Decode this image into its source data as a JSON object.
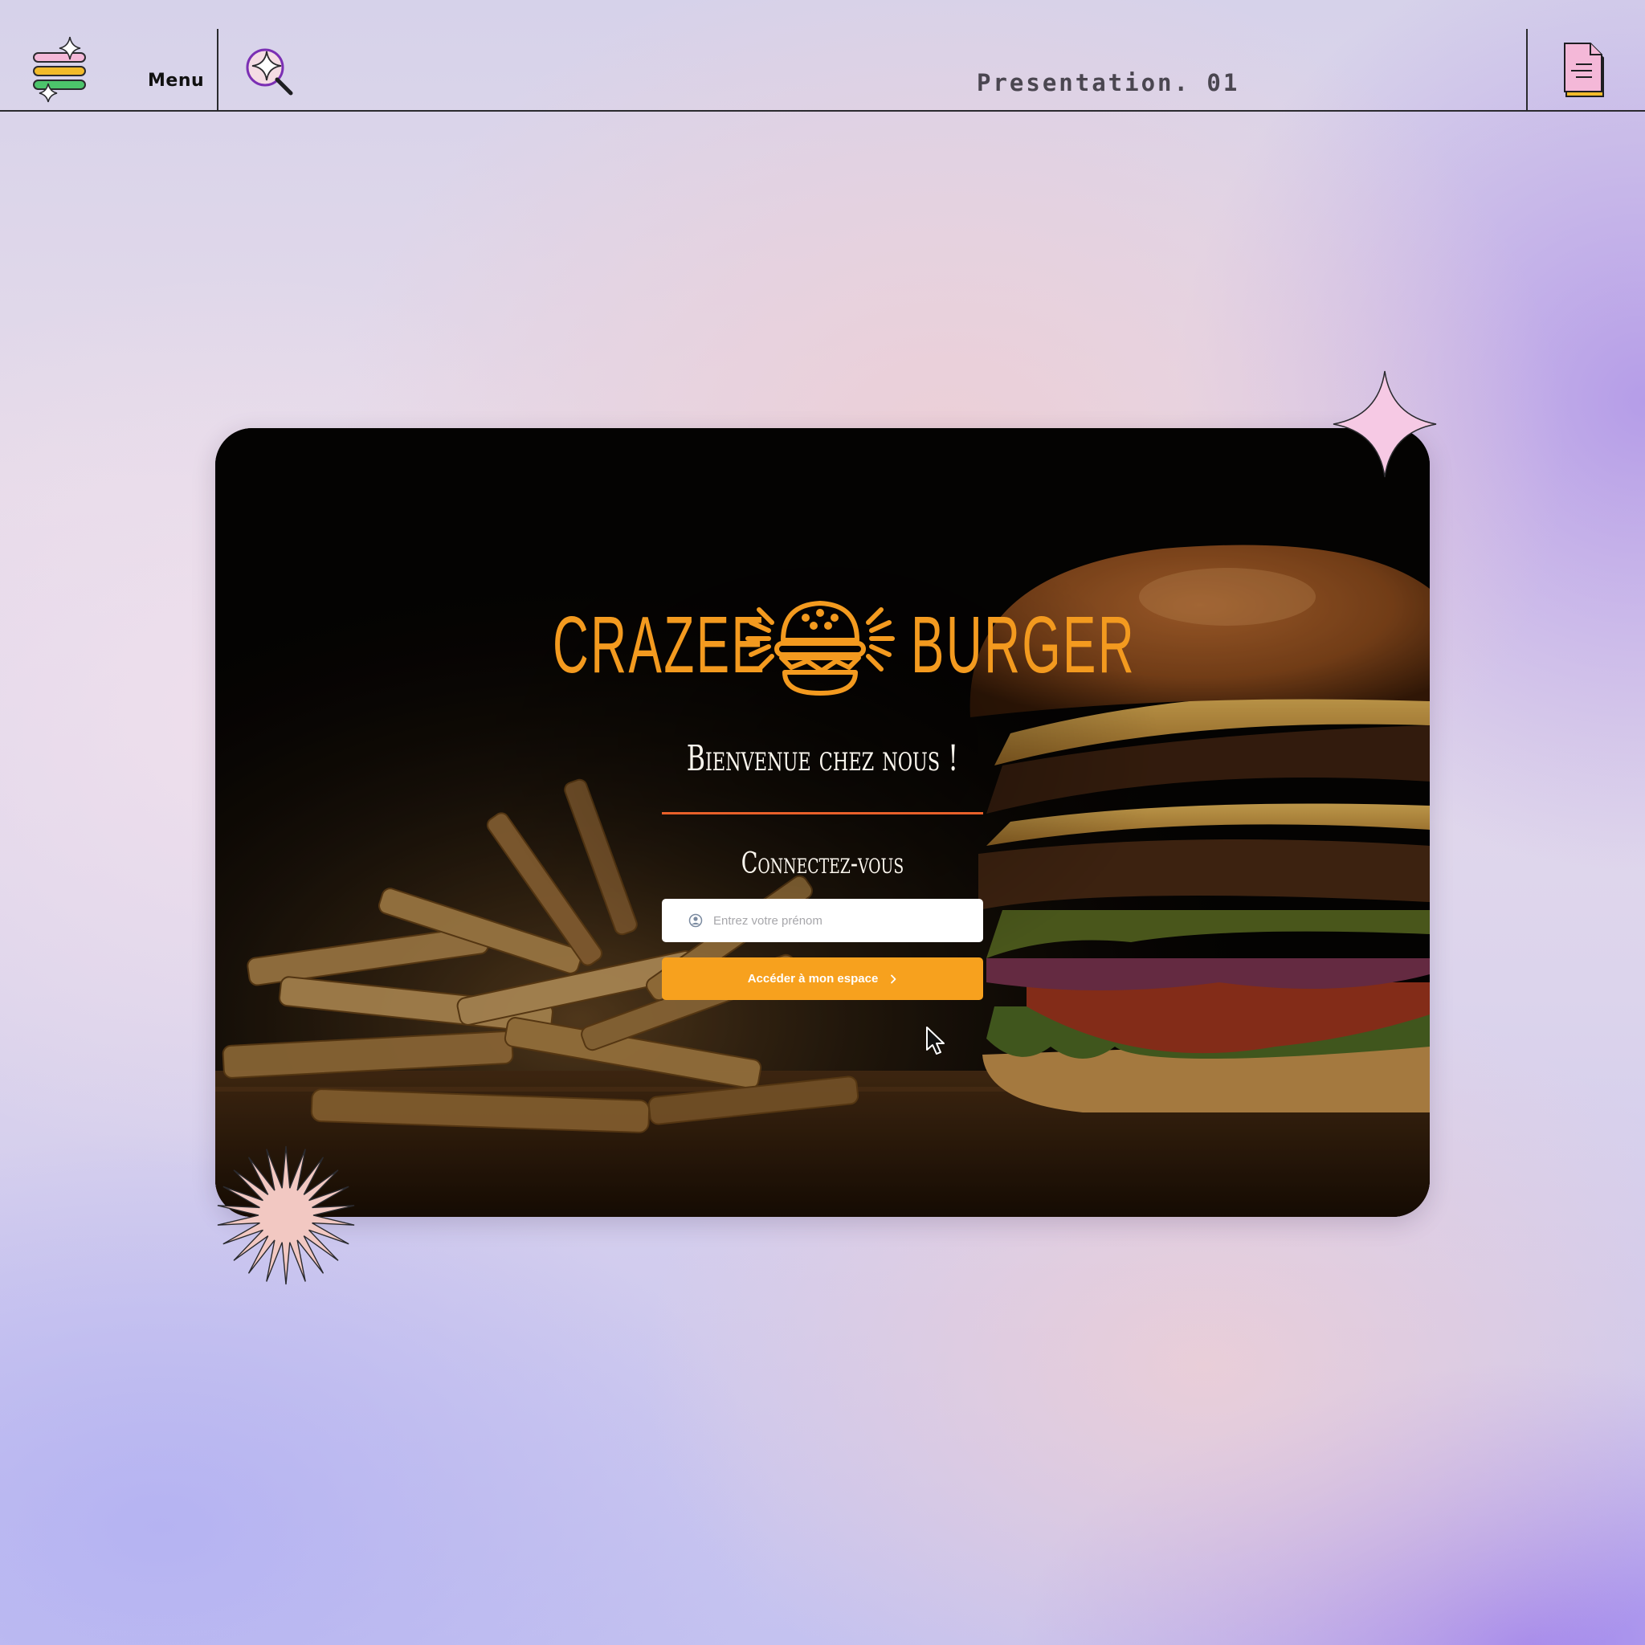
{
  "topbar": {
    "menu_label": "Menu",
    "title": "Presentation. 01",
    "icons": {
      "menu": "sparkle-menu-icon",
      "search": "sparkle-search-icon",
      "document": "document-icon"
    }
  },
  "card": {
    "logo": {
      "word_left": "CRAZEE",
      "word_right": "BURGER",
      "icon": "burger-icon",
      "color": "#f39a1f"
    },
    "welcome": "Bienvenue chez nous !",
    "divider_color": "#e8602a",
    "connect": "Connectez-vous",
    "name_input": {
      "placeholder": "Entrez votre prénom",
      "value": "",
      "icon": "user-icon"
    },
    "submit_button": {
      "label": "Accéder à mon espace",
      "icon": "chevron-right-icon",
      "color": "#f7a11e"
    }
  },
  "colors": {
    "accent_orange": "#f7a11e",
    "logo_orange": "#f39a1f",
    "star_pink": "#f6c9e4",
    "burst_peach": "#f2c8c2",
    "text_dark": "#111111"
  }
}
